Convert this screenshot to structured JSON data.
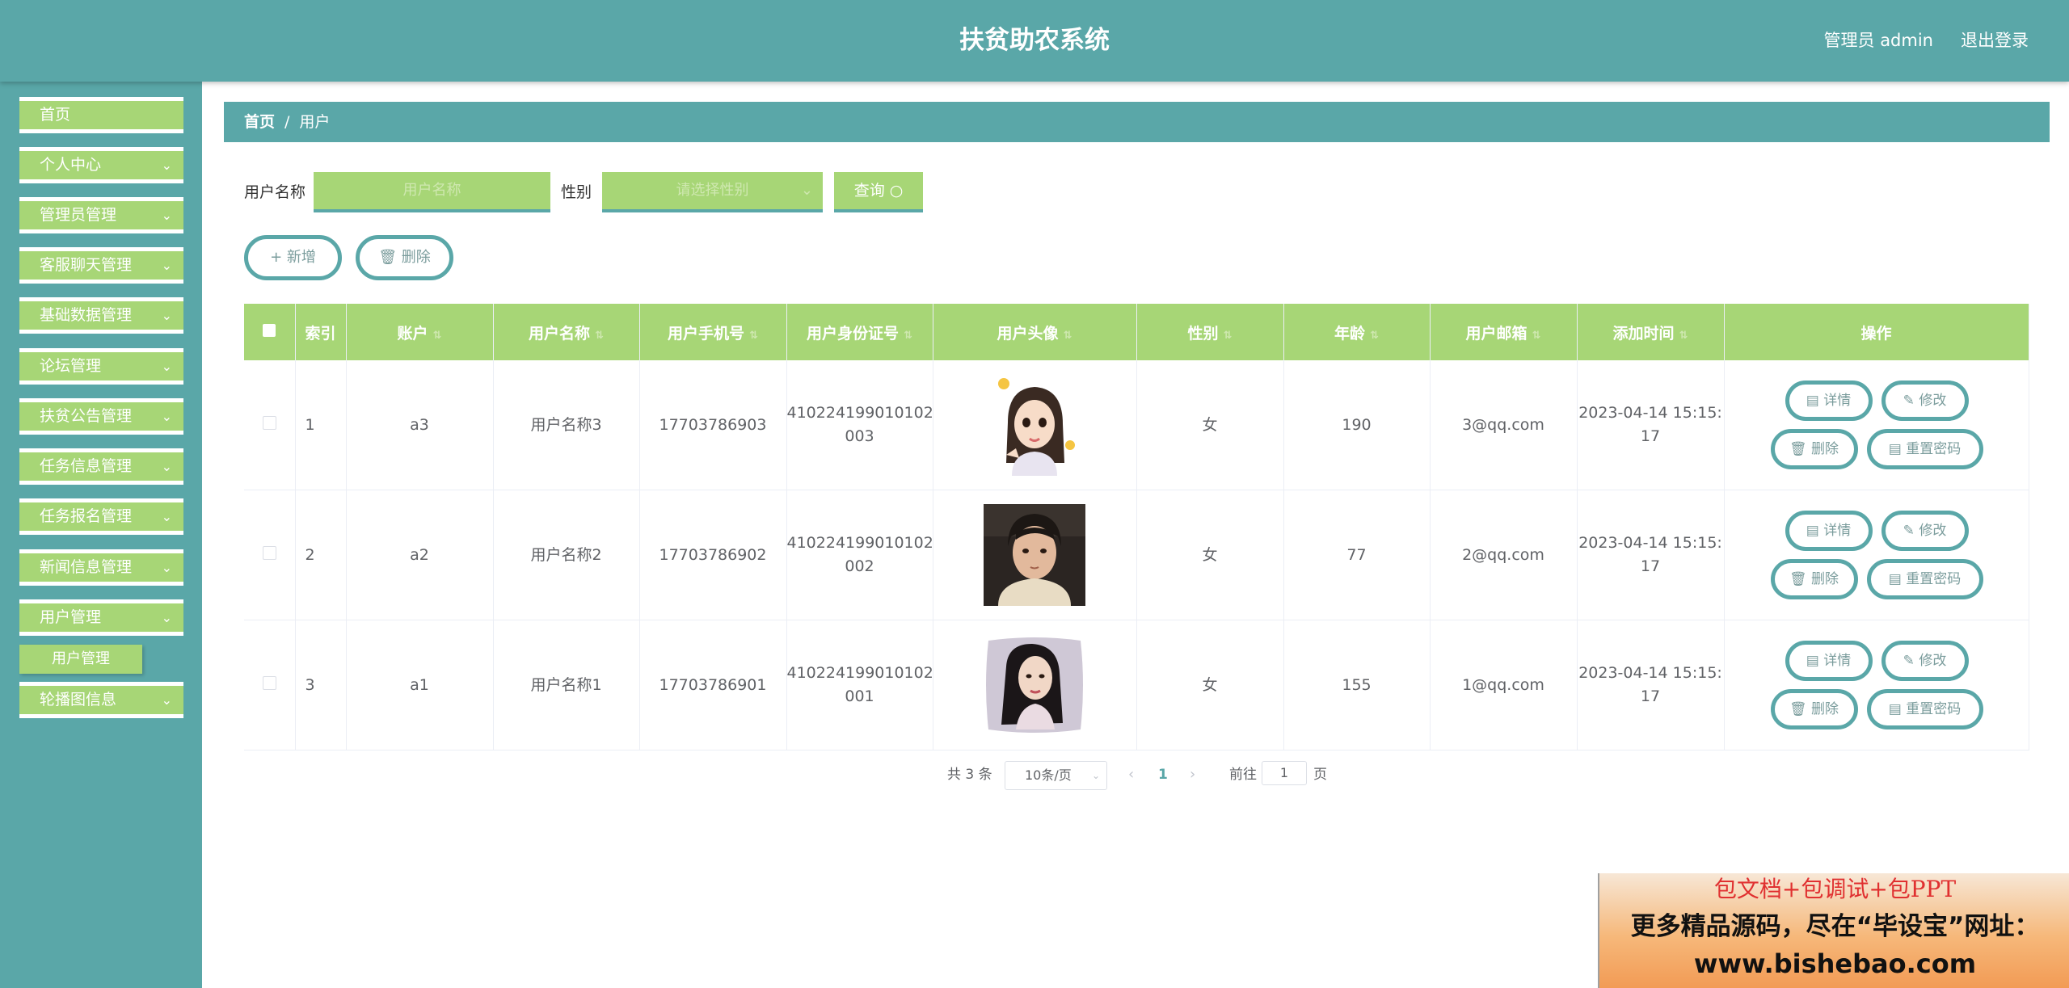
{
  "header": {
    "title": "扶贫助农系统",
    "admin": "管理员 admin",
    "logout": "退出登录"
  },
  "sidebar": {
    "items": [
      {
        "label": "首页"
      },
      {
        "label": "个人中心"
      },
      {
        "label": "管理员管理"
      },
      {
        "label": "客服聊天管理"
      },
      {
        "label": "基础数据管理"
      },
      {
        "label": "论坛管理"
      },
      {
        "label": "扶贫公告管理"
      },
      {
        "label": "任务信息管理"
      },
      {
        "label": "任务报名管理"
      },
      {
        "label": "新闻信息管理"
      },
      {
        "label": "用户管理"
      },
      {
        "label": "轮播图信息"
      }
    ],
    "sub_item": "用户管理",
    "chevron": "⌄"
  },
  "breadcrumb": {
    "home": "首页",
    "separator": "/",
    "current": "用户"
  },
  "search": {
    "name_label": "用户名称",
    "name_placeholder": "用户名称",
    "gender_label": "性别",
    "gender_placeholder": "请选择性别",
    "query_label": "查询 ○"
  },
  "actions": {
    "add": "+ 新增",
    "delete": "🗑 删除"
  },
  "table": {
    "columns": [
      "索引",
      "账户",
      "用户名称",
      "用户手机号",
      "用户身份证号",
      "用户头像",
      "性别",
      "年龄",
      "用户邮箱",
      "添加时间",
      "操作"
    ],
    "rows": [
      {
        "index": "1",
        "account": "a3",
        "name": "用户名称3",
        "phone": "17703786903",
        "id_line1": "410224199010102",
        "id_line2": "003",
        "gender": "女",
        "age": "190",
        "email": "3@qq.com",
        "time_line1": "2023-04-14 15:15:",
        "time_line2": "17",
        "avatar": "cartoon-girl-avatar"
      },
      {
        "index": "2",
        "account": "a2",
        "name": "用户名称2",
        "phone": "17703786902",
        "id_line1": "410224199010102",
        "id_line2": "002",
        "gender": "女",
        "age": "77",
        "email": "2@qq.com",
        "time_line1": "2023-04-14 15:15:",
        "time_line2": "17",
        "avatar": "young-man-photo"
      },
      {
        "index": "3",
        "account": "a1",
        "name": "用户名称1",
        "phone": "17703786901",
        "id_line1": "410224199010102",
        "id_line2": "001",
        "gender": "女",
        "age": "155",
        "email": "1@qq.com",
        "time_line1": "2023-04-14 15:15:",
        "time_line2": "17",
        "avatar": "woman-pillow-photo"
      }
    ],
    "op_labels": {
      "detail": "详情",
      "edit": "修改",
      "delete": "删除",
      "reset": "重置密码"
    }
  },
  "pagination": {
    "total": "共 3 条",
    "page_size": "10条/页",
    "current_page": "1",
    "goto_label": "前往",
    "goto_value": "1",
    "page_suffix": "页"
  },
  "banner": {
    "line1": "包文档+包调试+包PPT",
    "line2": "更多精品源码，尽在“毕设宝”网址：",
    "line3": "www.bishebao.com"
  },
  "colors": {
    "teal": "#5aa7a8",
    "green": "#a7d676"
  }
}
